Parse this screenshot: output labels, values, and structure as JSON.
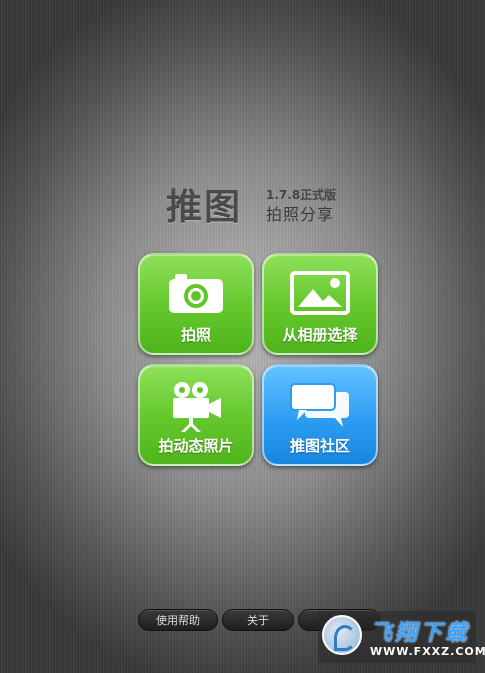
{
  "logo": {
    "main": "推图",
    "version": "1.7.8正式版",
    "subtitle": "拍照分享"
  },
  "tiles": [
    {
      "label": "拍照",
      "icon": "camera-icon",
      "color": "#65c92e"
    },
    {
      "label": "从相册选择",
      "icon": "picture-icon",
      "color": "#65c92e"
    },
    {
      "label": "拍动态照片",
      "icon": "video-camera-icon",
      "color": "#65c92e"
    },
    {
      "label": "推图社区",
      "icon": "chat-bubbles-icon",
      "color": "#2d9df2"
    }
  ],
  "bottom_bar": [
    {
      "label": "使用帮助"
    },
    {
      "label": "关于"
    },
    {
      "label": "退"
    }
  ],
  "watermark": {
    "title": "飞翔下载",
    "url": "WWW.FXXZ.COM"
  }
}
